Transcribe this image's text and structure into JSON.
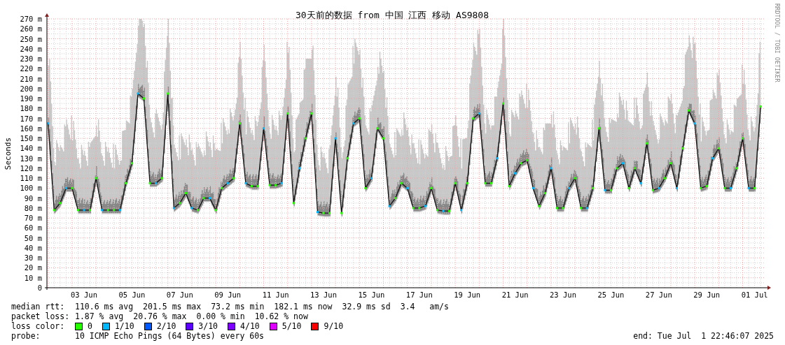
{
  "graph": {
    "credit": "RRDTOOL / TOBI OETIKER",
    "chart_data": {
      "type": "line",
      "title": "30天前的数据 from 中国 江西 移动 AS9808",
      "ylabel": "Seconds",
      "categories": [
        null,
        null,
        null,
        null,
        null,
        null,
        "03 Jun",
        null,
        null,
        null,
        null,
        null,
        null,
        null,
        "05 Jun",
        null,
        null,
        null,
        null,
        null,
        null,
        null,
        "07 Jun",
        null,
        null,
        null,
        null,
        null,
        null,
        null,
        "09 Jun",
        null,
        null,
        null,
        null,
        null,
        null,
        null,
        "11 Jun",
        null,
        null,
        null,
        null,
        null,
        null,
        null,
        "13 Jun",
        null,
        null,
        null,
        null,
        null,
        null,
        null,
        "15 Jun",
        null,
        null,
        null,
        null,
        null,
        null,
        null,
        "17 Jun",
        null,
        null,
        null,
        null,
        null,
        null,
        null,
        "19 Jun",
        null,
        null,
        null,
        null,
        null,
        null,
        null,
        "21 Jun",
        null,
        null,
        null,
        null,
        null,
        null,
        null,
        "23 Jun",
        null,
        null,
        null,
        null,
        null,
        null,
        null,
        "25 Jun",
        null,
        null,
        null,
        null,
        null,
        null,
        null,
        "27 Jun",
        null,
        null,
        null,
        null,
        null,
        null,
        null,
        "29 Jun",
        null,
        null,
        null,
        null,
        null,
        null,
        null,
        "01 Jul",
        null
      ],
      "values": [
        165,
        78,
        85,
        100,
        100,
        78,
        78,
        78,
        110,
        78,
        78,
        78,
        78,
        105,
        125,
        195,
        190,
        105,
        105,
        110,
        195,
        80,
        85,
        95,
        80,
        78,
        90,
        90,
        78,
        100,
        105,
        110,
        165,
        105,
        102,
        102,
        160,
        103,
        103,
        105,
        175,
        85,
        120,
        150,
        175,
        76,
        75,
        75,
        150,
        75,
        130,
        165,
        170,
        100,
        110,
        160,
        150,
        82,
        90,
        105,
        100,
        80,
        80,
        82,
        100,
        78,
        77,
        77,
        105,
        78,
        105,
        170,
        175,
        105,
        105,
        130,
        185,
        102,
        115,
        125,
        128,
        100,
        82,
        95,
        120,
        80,
        80,
        100,
        110,
        80,
        80,
        100,
        160,
        98,
        98,
        120,
        125,
        100,
        120,
        105,
        145,
        98,
        100,
        110,
        125,
        100,
        140,
        178,
        165,
        100,
        102,
        130,
        140,
        100,
        100,
        120,
        150,
        100,
        100,
        182
      ],
      "grid": true,
      "marker": true,
      "ylim": [
        0,
        270
      ],
      "yticks": [
        0,
        {
          "value": 10,
          "label": "10 m"
        },
        {
          "value": 20,
          "label": "20 m"
        },
        {
          "value": 30,
          "label": "30 m"
        },
        {
          "value": 40,
          "label": "40 m"
        },
        {
          "value": 50,
          "label": "50 m"
        },
        {
          "value": 60,
          "label": "60 m"
        },
        {
          "value": 70,
          "label": "70 m"
        },
        {
          "value": 80,
          "label": "80 m"
        },
        {
          "value": 90,
          "label": "90 m"
        },
        {
          "value": 100,
          "label": "100 m"
        },
        {
          "value": 110,
          "label": "110 m"
        },
        {
          "value": 120,
          "label": "120 m"
        },
        {
          "value": 130,
          "label": "130 m"
        },
        {
          "value": 140,
          "label": "140 m"
        },
        {
          "value": 150,
          "label": "150 m"
        },
        {
          "value": 160,
          "label": "160 m"
        },
        {
          "value": 170,
          "label": "170 m"
        },
        {
          "value": 180,
          "label": "180 m"
        },
        {
          "value": 190,
          "label": "190 m"
        },
        {
          "value": 200,
          "label": "200 m"
        },
        {
          "value": 210,
          "label": "210 m"
        },
        {
          "value": 220,
          "label": "220 m"
        },
        {
          "value": 230,
          "label": "230 m"
        },
        {
          "value": 240,
          "label": "240 m"
        },
        {
          "value": 250,
          "label": "250 m"
        },
        {
          "value": 260,
          "label": "260 m"
        },
        {
          "value": 270,
          "label": "270 m"
        }
      ]
    }
  },
  "legend": {
    "rows": [
      {
        "label": "median rtt:",
        "values": [
          "110.6 ms avg",
          "201.5 ms max",
          "73.2 ms min",
          "182.1 ms now",
          "32.9 ms sd",
          "3.4   am/s"
        ]
      },
      {
        "label": "packet loss:",
        "values": [
          "1.87 % avg",
          "20.76 % max",
          "0.00 % min",
          "10.62 % now"
        ]
      }
    ],
    "loss_color": {
      "label": "loss color:",
      "items": [
        {
          "label": "0",
          "color": "#26ff00"
        },
        {
          "label": "1/10",
          "color": "#00b8ff"
        },
        {
          "label": "2/10",
          "color": "#0059ff"
        },
        {
          "label": "3/10",
          "color": "#5e00ff"
        },
        {
          "label": "4/10",
          "color": "#7e00ff"
        },
        {
          "label": "5/10",
          "color": "#dd00ff"
        },
        {
          "label": "9/10",
          "color": "#ff0000"
        }
      ]
    },
    "probe": {
      "label": "probe:",
      "value": "10 ICMP Echo Pings (64 Bytes) every 60s"
    },
    "end": "end: Tue Jul  1 22:46:07 2025"
  }
}
